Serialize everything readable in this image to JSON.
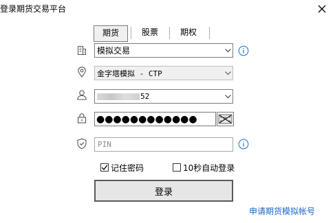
{
  "window": {
    "title": "登录期货交易平台",
    "close_icon": "close-icon"
  },
  "tabs": [
    {
      "label": "期货",
      "active": true
    },
    {
      "label": "股票",
      "active": false
    },
    {
      "label": "期权",
      "active": false
    }
  ],
  "form": {
    "mode": {
      "icon": "building-icon",
      "value": "模拟交易",
      "info_icon": "info-icon"
    },
    "server": {
      "icon": "location-pin-icon",
      "value": "金字塔模拟 - CTP",
      "disabled": true
    },
    "account": {
      "icon": "user-icon",
      "visible_suffix": "52",
      "masked": true
    },
    "password": {
      "icon": "lock-icon",
      "dots": "●●●●●●●●●●●●",
      "keyboard_icon": "virtual-keyboard-icon"
    },
    "pin": {
      "icon": "shield-icon",
      "placeholder": "PIN",
      "info_icon": "info-icon"
    }
  },
  "options": {
    "remember_password": {
      "label": "记住密码",
      "checked": true
    },
    "auto_login": {
      "label": "10秒自动登录",
      "checked": false
    }
  },
  "login_button": "登录",
  "apply_link": "申请期货模拟帐号",
  "colors": {
    "link": "#1b66c4",
    "info": "#2e7bd6",
    "border": "#7a7a7a"
  }
}
